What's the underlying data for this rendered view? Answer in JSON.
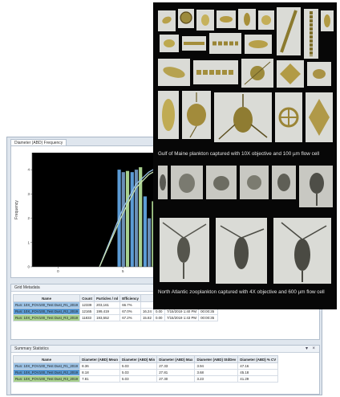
{
  "chart_data": {
    "type": "bar",
    "title": "",
    "xlabel": "",
    "ylabel": "Frequency",
    "ylim": [
      0,
      4.7
    ],
    "xlim": [
      -2,
      20
    ],
    "xticks": [
      0,
      5,
      10
    ],
    "yticks": [
      0,
      1,
      2,
      3,
      4
    ],
    "bar_x": [
      5,
      6,
      7,
      8,
      9,
      10
    ],
    "series": [
      {
        "color": "#5b9bd5",
        "values": [
          4.0,
          3.9,
          2.9,
          1.05,
          0.6,
          0.35
        ]
      },
      {
        "color": "#6b8fb6",
        "values": [
          3.9,
          4.0,
          2.0,
          1.3,
          0.55,
          0.25
        ]
      },
      {
        "color": "#a9d18e",
        "values": [
          3.95,
          4.1,
          2.7,
          0.8,
          0.45,
          0.3
        ]
      }
    ],
    "cumulative_x": [
      3.2,
      5,
      6,
      7,
      8,
      9,
      10,
      12,
      14,
      16,
      18,
      20
    ],
    "cumulative": [
      {
        "color": "#9cc3e6",
        "values": [
          0.0,
          2.4,
          3.4,
          3.9,
          4.2,
          4.35,
          4.45,
          4.55,
          4.6,
          4.63,
          4.65,
          4.66
        ]
      },
      {
        "color": "#c9e2b3",
        "values": [
          0.0,
          2.2,
          3.25,
          3.8,
          4.1,
          4.3,
          4.4,
          4.52,
          4.58,
          4.61,
          4.63,
          4.64
        ]
      }
    ]
  },
  "panels": {
    "chart_tab": "Diameter (ABD) Frequency",
    "grid_tab": "Grid Metadata",
    "stats_tab": "Summary Statistics",
    "pin_icon": "pin-icon",
    "close_icon": "close-icon",
    "pin_glyph": "▾",
    "close_glyph": "×"
  },
  "grid_metadata": {
    "columns": [
      "Name",
      "Count",
      "Particles / ml",
      "Efficiency",
      "",
      "",
      "",
      ""
    ],
    "rows": [
      {
        "color": "#9dc3e6",
        "cells": [
          "Run: 10X_FOV100_Test Dust_R1_2019",
          "12339",
          "203,161",
          "66.7%",
          "",
          "",
          "",
          ""
        ]
      },
      {
        "color": "#5b9bd5",
        "cells": [
          "Run: 10X_FOV100_Test Dust_R2_2019",
          "12165",
          "199,419",
          "67.0%",
          "16.24",
          "0.00",
          "7/15/2019 1:40 PM",
          "00:00:35"
        ]
      },
      {
        "color": "#a9d18e",
        "cells": [
          "Run: 10X_FOV100_Test Dust_R3_2019",
          "11833",
          "193,552",
          "67.2%",
          "15.82",
          "0.00",
          "7/15/2019 1:43 PM",
          "00:00:35"
        ]
      }
    ]
  },
  "summary_statistics": {
    "columns": [
      "Name",
      "Diameter (ABD) Mean",
      "Diameter (ABD) Min",
      "Diameter (ABD) Max",
      "Diameter (ABD) StdDev",
      "Diameter (ABD) % CV"
    ],
    "rows": [
      {
        "color": "#9dc3e6",
        "cells": [
          "Run: 10X_FOV100_Test Dust_R1_2019",
          "8.36",
          "5.03",
          "27.33",
          "3.94",
          "47.16"
        ]
      },
      {
        "color": "#5b9bd5",
        "cells": [
          "Run: 10X_FOV100_Test Dust_R2_2019",
          "8.18",
          "5.03",
          "27.81",
          "3.68",
          "45.18"
        ]
      },
      {
        "color": "#a9d18e",
        "cells": [
          "Run: 10X_FOV100_Test Dust_R3_2019",
          "7.81",
          "5.03",
          "27.30",
          "3.23",
          "41.29"
        ]
      }
    ]
  },
  "captions": {
    "top": "Gulf of Maine plankton captured with 10X objective and 100 µm flow cell",
    "bottom": "North Atlantic zooplankton captured with 4X objective and 600 µm flow cell"
  }
}
